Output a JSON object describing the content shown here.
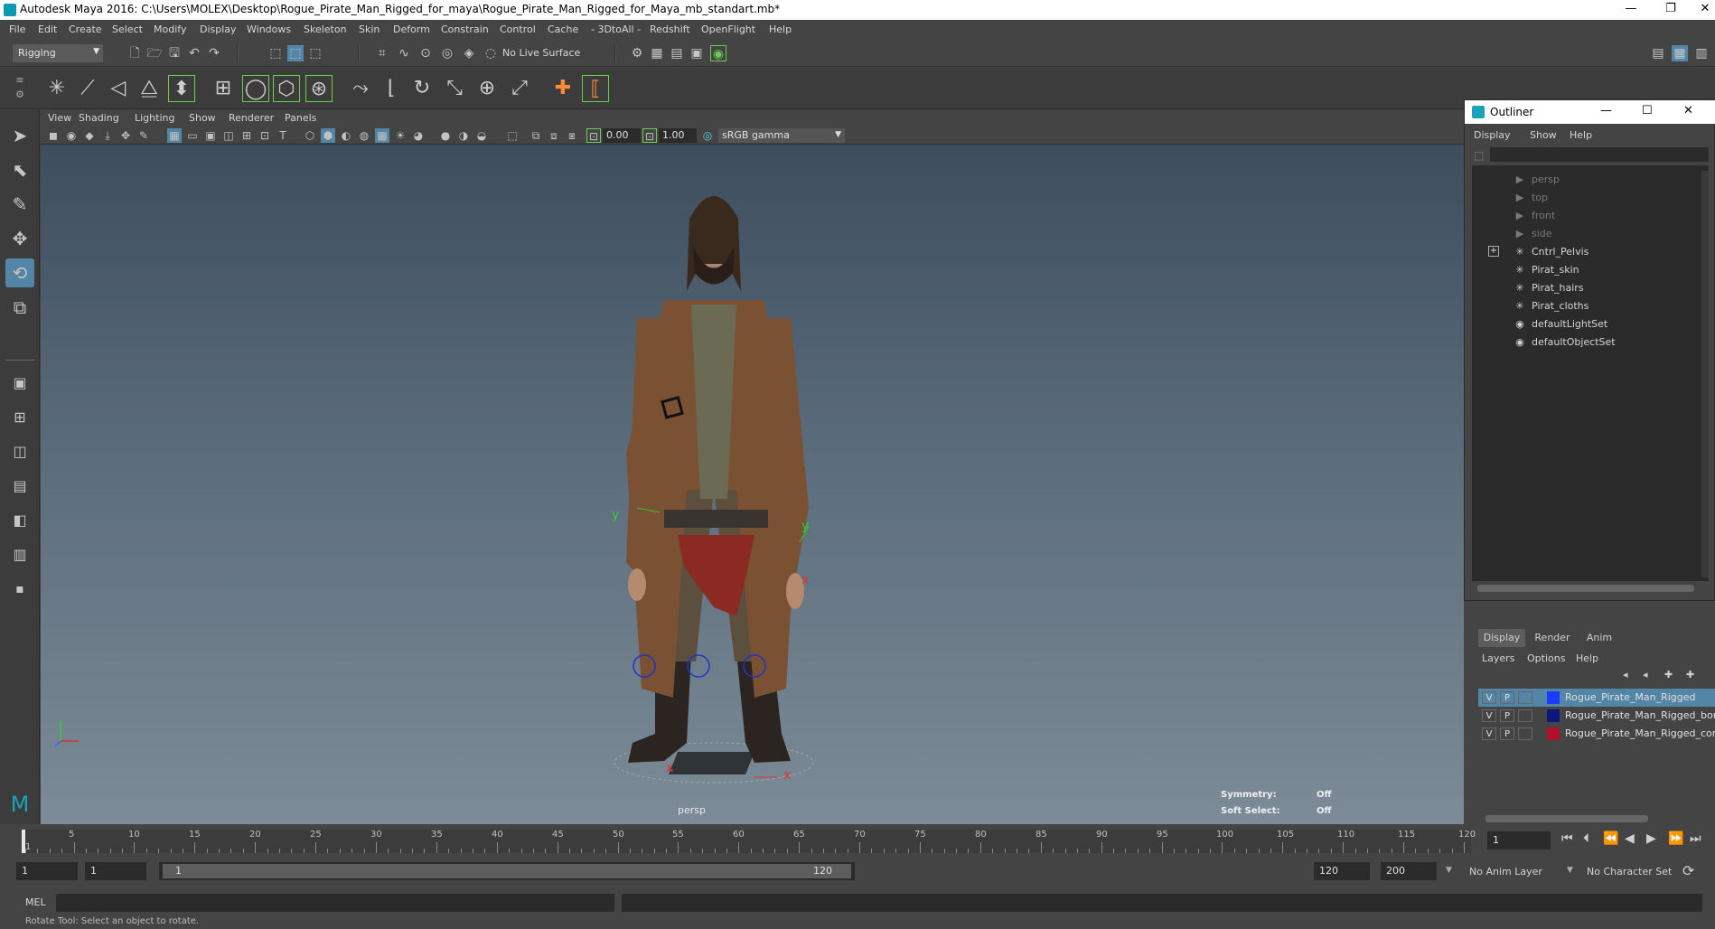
{
  "window": {
    "title": "Autodesk Maya 2016: C:\\Users\\MOLEX\\Desktop\\Rogue_Pirate_Man_Rigged_for_maya\\Rogue_Pirate_Man_Rigged_for_Maya_mb_standart.mb*",
    "minimize": "—",
    "restore": "❐",
    "close": "✕"
  },
  "menu": [
    "File",
    "Edit",
    "Create",
    "Select",
    "Modify",
    "Display",
    "Windows",
    "Skeleton",
    "Skin",
    "Deform",
    "Constrain",
    "Control",
    "Cache",
    "- 3DtoAll -",
    "Redshift",
    "OpenFlight",
    "Help"
  ],
  "status": {
    "menuset": "Rigging",
    "live_surface": "No Live Surface"
  },
  "viewport": {
    "menu": [
      "View",
      "Shading",
      "Lighting",
      "Show",
      "Renderer",
      "Panels"
    ],
    "exposure": "0.00",
    "gamma": "1.00",
    "colorspace": "sRGB gamma",
    "camera_label": "persp",
    "hud": {
      "symmetry_label": "Symmetry:",
      "symmetry_value": "Off",
      "soft_select_label": "Soft Select:",
      "soft_select_value": "Off"
    },
    "axis_y": "y",
    "axis_x": "x"
  },
  "outliner": {
    "title": "Outliner",
    "menu": [
      "Display",
      "Show",
      "Help"
    ],
    "items": [
      {
        "label": "persp",
        "icon": "camera-icon",
        "dim": true
      },
      {
        "label": "top",
        "icon": "camera-icon",
        "dim": true
      },
      {
        "label": "front",
        "icon": "camera-icon",
        "dim": true
      },
      {
        "label": "side",
        "icon": "camera-icon",
        "dim": true
      },
      {
        "label": "Cntrl_Pelvis",
        "icon": "transform-icon",
        "dim": false,
        "expandable": true
      },
      {
        "label": "Pirat_skin",
        "icon": "transform-icon",
        "dim": false
      },
      {
        "label": "Pirat_hairs",
        "icon": "transform-icon",
        "dim": false
      },
      {
        "label": "Pirat_cloths",
        "icon": "transform-icon",
        "dim": false
      },
      {
        "label": "defaultLightSet",
        "icon": "set-icon",
        "dim": false
      },
      {
        "label": "defaultObjectSet",
        "icon": "set-icon",
        "dim": false
      }
    ]
  },
  "layers": {
    "tabs": [
      "Display",
      "Render",
      "Anim"
    ],
    "menu": [
      "Layers",
      "Options",
      "Help"
    ],
    "rows": [
      {
        "v": "V",
        "p": "P",
        "color": "#1a3cff",
        "name": "Rogue_Pirate_Man_Rigged",
        "selected": true
      },
      {
        "v": "V",
        "p": "P",
        "color": "#0a1a7a",
        "name": "Rogue_Pirate_Man_Rigged_bones",
        "selected": false
      },
      {
        "v": "V",
        "p": "P",
        "color": "#b0102a",
        "name": "Rogue_Pirate_Man_Rigged_controllers",
        "selected": false
      }
    ]
  },
  "timeline": {
    "ticks": [
      "5",
      "10",
      "15",
      "20",
      "25",
      "30",
      "35",
      "40",
      "45",
      "50",
      "55",
      "60",
      "65",
      "70",
      "75",
      "80",
      "85",
      "90",
      "95",
      "100",
      "105",
      "110",
      "115",
      "120"
    ],
    "start_tick": "1",
    "current_frame": "1"
  },
  "range": {
    "start": "1",
    "playback_start": "1",
    "slider_start": "1",
    "slider_end": "120",
    "playback_end": "120",
    "end": "200",
    "anim_layer": "No Anim Layer",
    "character_set": "No Character Set"
  },
  "command": {
    "lang": "MEL"
  },
  "help_line": "Rotate Tool: Select an object to rotate."
}
